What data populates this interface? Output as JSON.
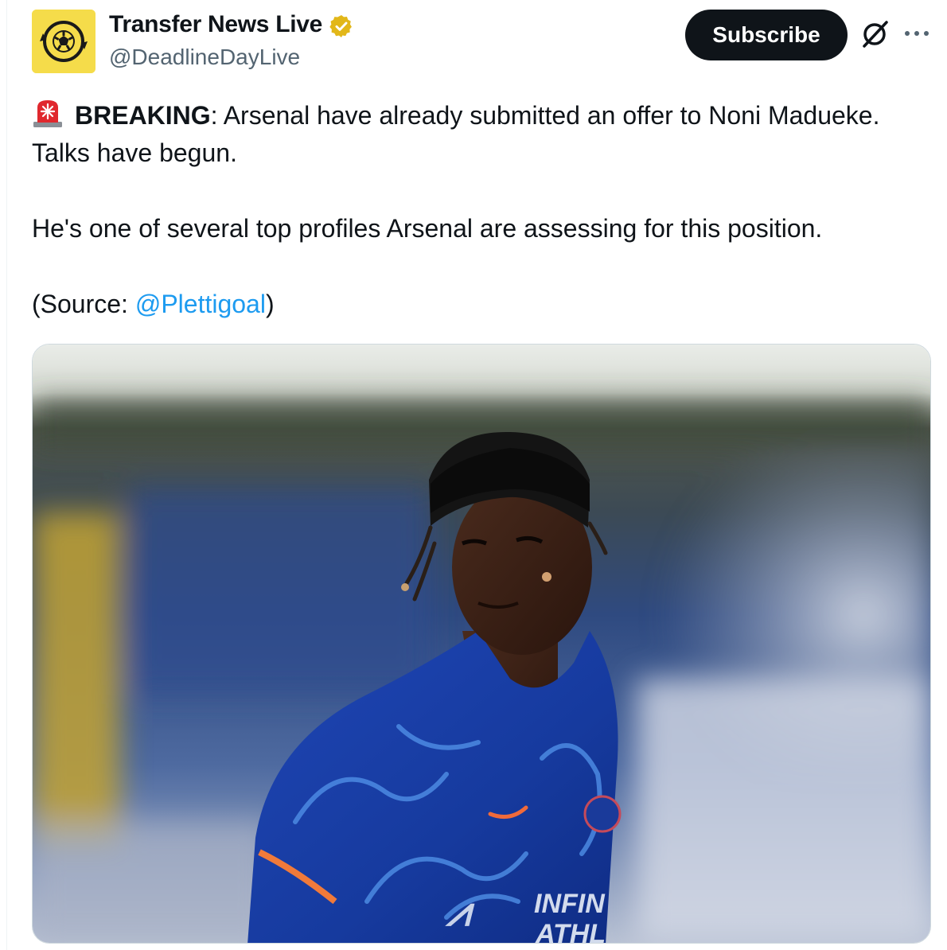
{
  "author": {
    "display_name": "Transfer News Live",
    "handle": "@DeadlineDayLive",
    "avatar_icon": "football-logo-icon",
    "verified_icon": "gold-verified-badge-icon",
    "avatar_color": "#f5dc4a"
  },
  "actions": {
    "subscribe_label": "Subscribe",
    "grok_icon": "grok-icon",
    "more_icon": "more-horizontal-icon"
  },
  "tweet": {
    "siren_icon": "rotating-light-emoji",
    "breaking_label": "BREAKING",
    "line1_rest": ": Arsenal have already submitted an offer to Noni Madueke.",
    "line2": "Talks have begun.",
    "para2": "He's one of several top profiles Arsenal are assessing for this position.",
    "source_open": "(Source: ",
    "source_mention": "@Plettigoal",
    "source_close": ")"
  },
  "media": {
    "type": "photo",
    "kit_text_line1": "INFIN",
    "kit_text_line2": "ATHL"
  },
  "colors": {
    "text": "#0f1419",
    "secondary": "#536471",
    "link": "#1d9bf0",
    "button_bg": "#0f1419"
  }
}
